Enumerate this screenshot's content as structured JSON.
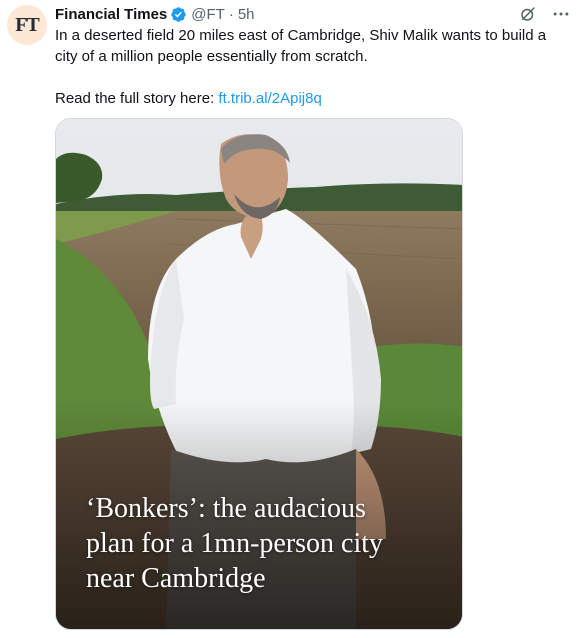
{
  "tweet": {
    "author_name": "Financial Times",
    "avatar_text": "FT",
    "handle": "@FT",
    "separator": "·",
    "time": "5h",
    "text_line1": "In a deserted field 20 miles east of Cambridge, Shiv Malik wants to build a",
    "text_line2": "city of a million people essentially from scratch.",
    "read_more_prefix": "Read the full story here: ",
    "link_text": "ft.trib.al/2Apij8q"
  },
  "media": {
    "headline_line1": "‘Bonkers’: the audacious",
    "headline_line2": "plan for a 1mn-person city",
    "headline_line3": "near Cambridge"
  },
  "icons": {
    "verified": "verified-badge-icon",
    "grok": "grok-icon",
    "more": "more-options-icon"
  },
  "colors": {
    "accent": "#1d9bf0",
    "avatar_bg": "#fce8d5",
    "text": "#0f1419",
    "muted": "#536471"
  }
}
